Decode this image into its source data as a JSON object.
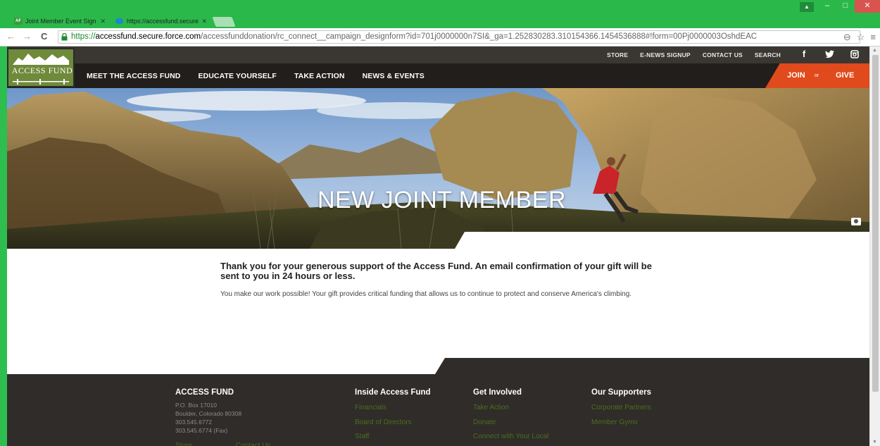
{
  "browser": {
    "tabs": [
      {
        "title": "Joint Member Event Sign",
        "active": false
      },
      {
        "title": "https://accessfund.secure",
        "active": true
      }
    ],
    "url": {
      "scheme": "https://",
      "host": "accessfund.secure.force.com",
      "path": "/accessfunddonation/rc_connect__campaign_designform?id=701j0000000n7SI&_ga=1.252830283.310154366.1454536888#!form=00Pj0000003OshdEAC"
    }
  },
  "site": {
    "logo_text": "ACCESS FUND",
    "utility_nav": [
      "STORE",
      "E-NEWS SIGNUP",
      "CONTACT US",
      "SEARCH"
    ],
    "social": [
      {
        "icon": "facebook-icon",
        "glyph": "f"
      },
      {
        "icon": "twitter-icon",
        "glyph": "❀"
      },
      {
        "icon": "instagram-icon",
        "glyph": "▣"
      }
    ],
    "main_nav": [
      "MEET THE ACCESS FUND",
      "EDUCATE YOURSELF",
      "TAKE ACTION",
      "NEWS & EVENTS"
    ],
    "join_label": "JOIN",
    "or_label": "or",
    "give_label": "GIVE"
  },
  "hero": {
    "title": "NEW JOINT MEMBER",
    "camera_icon": "camera-icon"
  },
  "content": {
    "heading": "Thank you for your generous support of the Access Fund. An email confirmation of your gift will be sent to you in 24 hours or less.",
    "body": "You make our work possible! Your gift provides critical funding that allows us to continue to protect and conserve America's climbing."
  },
  "footer": {
    "org": {
      "title": "ACCESS FUND",
      "address": [
        "P.O. Box 17010",
        "Boulder, Colorado 80308",
        "303.545.6772",
        "303.545.6774 (Fax)"
      ],
      "links": [
        "Store",
        "Contact Us"
      ]
    },
    "columns": [
      {
        "title": "Inside Access Fund",
        "links": [
          "Financials",
          "Board of Directors",
          "Staff"
        ]
      },
      {
        "title": "Get Involved",
        "links": [
          "Take Action",
          "Donate",
          "Connect with Your Local"
        ]
      },
      {
        "title": "Our Supporters",
        "links": [
          "Corporate Partners",
          "Member Gyms"
        ]
      }
    ]
  },
  "colors": {
    "chrome_green": "#2bb84b",
    "header_dark": "#211e1c",
    "accent_orange": "#e04a1c",
    "footer_bg": "#2f2c29",
    "footer_link": "#4e6d1f"
  }
}
